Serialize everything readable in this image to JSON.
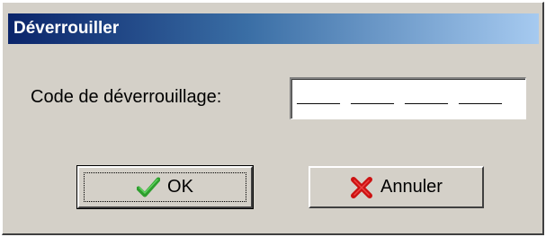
{
  "dialog": {
    "title": "Déverrouiller"
  },
  "form": {
    "code_label": "Code de déverrouillage:",
    "code_value": "____ ____ ____ ____"
  },
  "buttons": {
    "ok_label": "OK",
    "ok_icon": "checkmark-icon",
    "cancel_label": "Annuler",
    "cancel_icon": "red-x-icon"
  },
  "colors": {
    "title_bar_start": "#0a246a",
    "title_bar_end": "#a6caf0",
    "dialog_face": "#d4d0c8",
    "ok_icon": "#2e9e2e",
    "cancel_icon": "#cc1111"
  }
}
